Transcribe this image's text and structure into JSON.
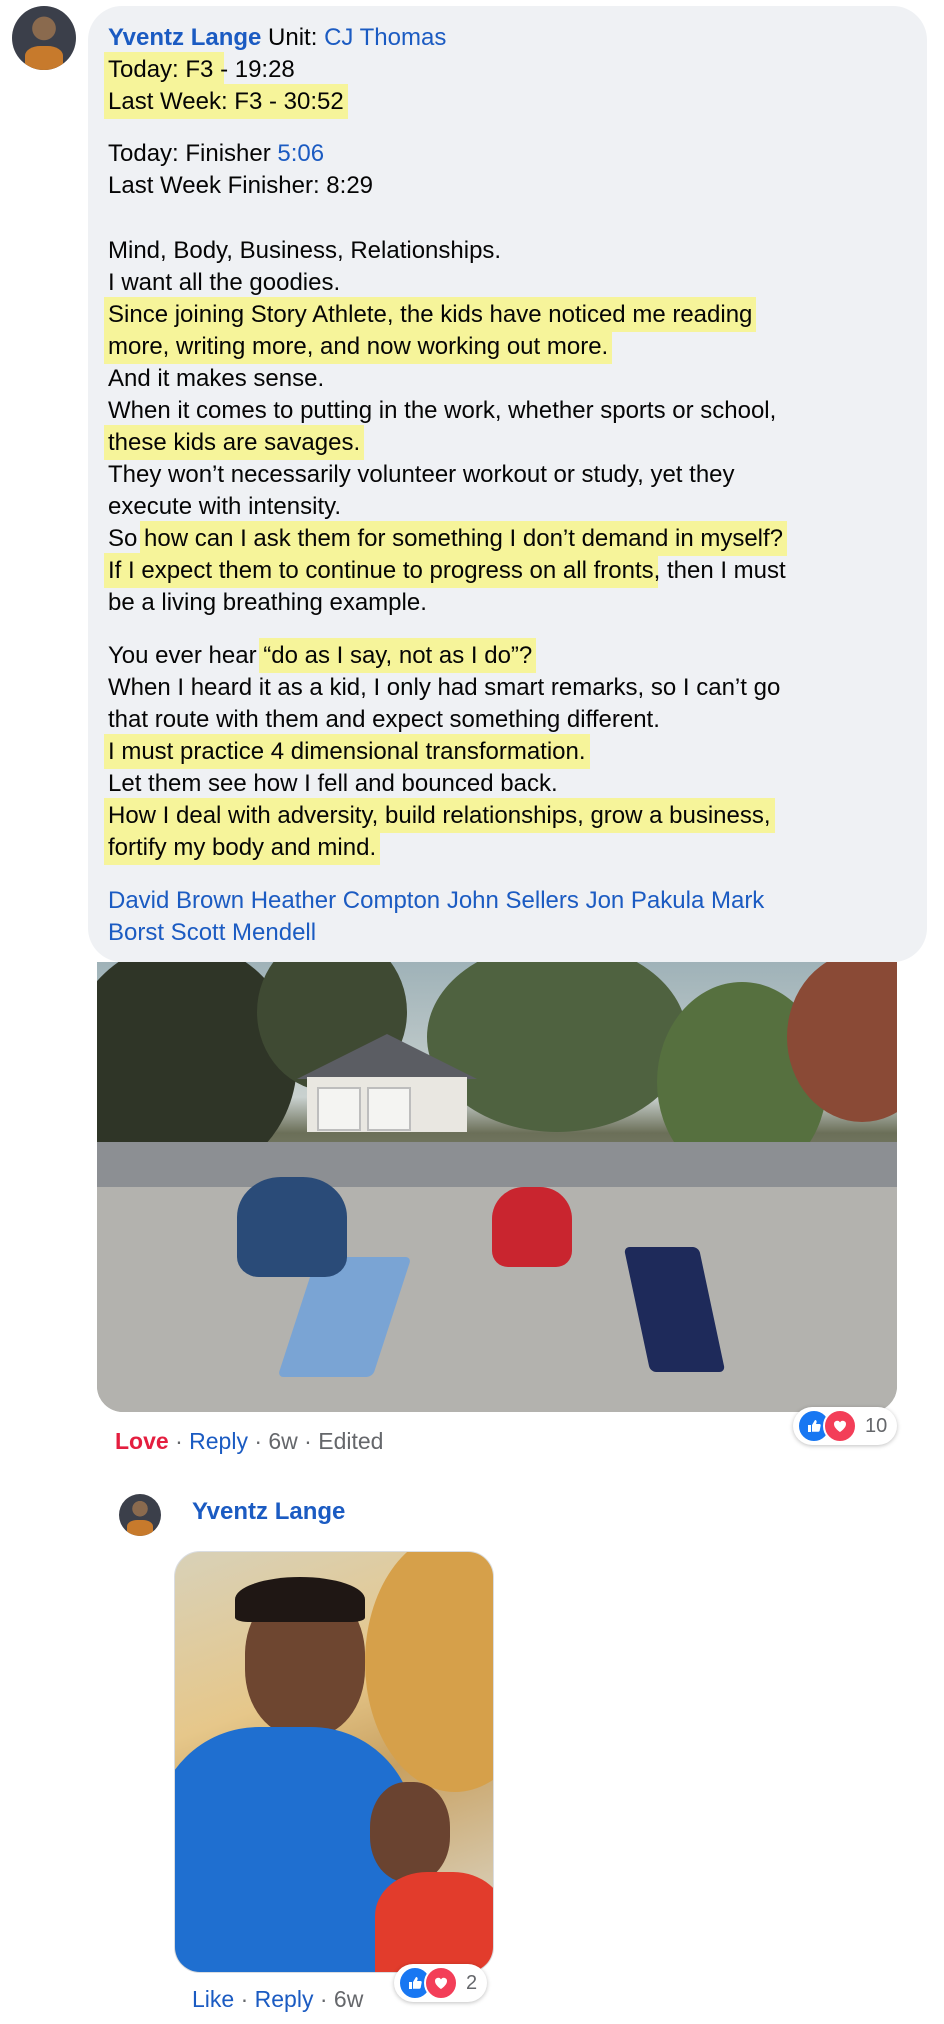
{
  "comment": {
    "author": "Yventz Lange",
    "unit_label": " Unit: ",
    "unit_name": "CJ Thomas",
    "today_f3_label": "Today: F3 ",
    "today_f3_time": "- 19:28",
    "last_week_f3": "Last Week: F3 - 30:52",
    "today_finisher_label": "Today: Finisher ",
    "today_finisher_time": "5:06",
    "last_week_finisher": "Last Week Finisher: 8:29",
    "lines": {
      "l1": "Mind, Body, Business, Relationships.",
      "l2": "I want all the goodies.",
      "l3": "Since joining Story Athlete, the kids have noticed me reading",
      "l4": "more, writing more, and now working out more.",
      "l5": "And it makes sense.",
      "l6": "When it comes to putting in the work, whether sports or school,",
      "l7": "these kids are savages.",
      "l8": "They won’t necessarily volunteer workout or study, yet they",
      "l9": "execute with intensity.",
      "l10a": "So ",
      "l10b": "how can I ask them for something I don’t demand in myself?",
      "l11a": "If I expect them to continue to progress on all fronts",
      "l11b": ", then I must",
      "l12": "be a living breathing example.",
      "l13a": "You ever hear ",
      "l13b": "“do as I say, not as I do”?",
      "l14": "When I heard it as a kid, I only had smart remarks, so I can’t go",
      "l15": "that route with them and expect something different.",
      "l16": "I must practice 4 dimensional transformation.",
      "l17": "Let them see how I fell and bounced back.",
      "l18": "How I deal with adversity, build relationships, grow a business,",
      "l19": "fortify my body and mind."
    },
    "tags_line1": "David Brown Heather Compton John Sellers Jon Pakula Mark",
    "tags_line2": "Borst Scott Mendell",
    "actions": {
      "love": "Love",
      "sep1": " · ",
      "reply": "Reply",
      "age": " · 6w · Edited"
    },
    "reaction_count": "10"
  },
  "reply": {
    "author": "Yventz Lange",
    "actions": {
      "like": "Like",
      "sep1": " · ",
      "reply": "Reply",
      "age": " · 6w"
    },
    "reaction_count": "2"
  },
  "colors": {
    "link": "#1b5bc2",
    "highlight": "#f6f49a",
    "bubble": "#eff1f4",
    "love": "#e41e3f"
  },
  "icons": {
    "like": "thumbs-up-icon",
    "love": "heart-icon"
  }
}
